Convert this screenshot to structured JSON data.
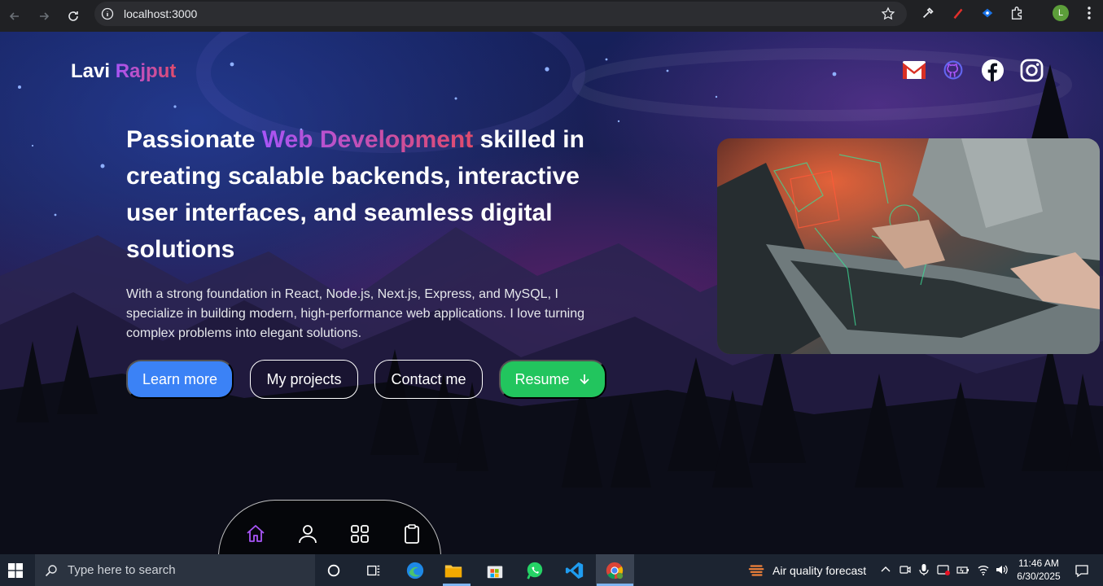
{
  "browser": {
    "url": "localhost:3000"
  },
  "site": {
    "logo_first": "Lavi",
    "logo_last": "Rajput",
    "socials": [
      "gmail-icon",
      "github-icon",
      "facebook-icon",
      "instagram-icon"
    ]
  },
  "hero": {
    "headline_pre": "Passionate ",
    "headline_accent": "Web Development",
    "headline_post": " skilled in creating scalable backends, interactive user interfaces, and seamless digital solutions",
    "description": "With a strong foundation in React, Node.js, Next.js, Express, and MySQL, I specialize in building modern, high-performance web applications. I love turning complex problems into elegant solutions.",
    "buttons": {
      "learn_more": "Learn more",
      "my_projects": "My projects",
      "contact_me": "Contact me",
      "resume": "Resume"
    }
  },
  "dock": {
    "items": [
      "home-icon",
      "user-icon",
      "grid-icon",
      "clipboard-icon"
    ],
    "active_color": "#a855f7"
  },
  "taskbar": {
    "search_placeholder": "Type here to search",
    "weather": "Air quality forecast",
    "time": "11:46 AM",
    "date": "6/30/2025"
  },
  "colors": {
    "accent_purple": "#a855f7",
    "accent_red": "#e14b6b",
    "learn_btn": "#3b82f6",
    "resume_btn": "#22c55e"
  }
}
